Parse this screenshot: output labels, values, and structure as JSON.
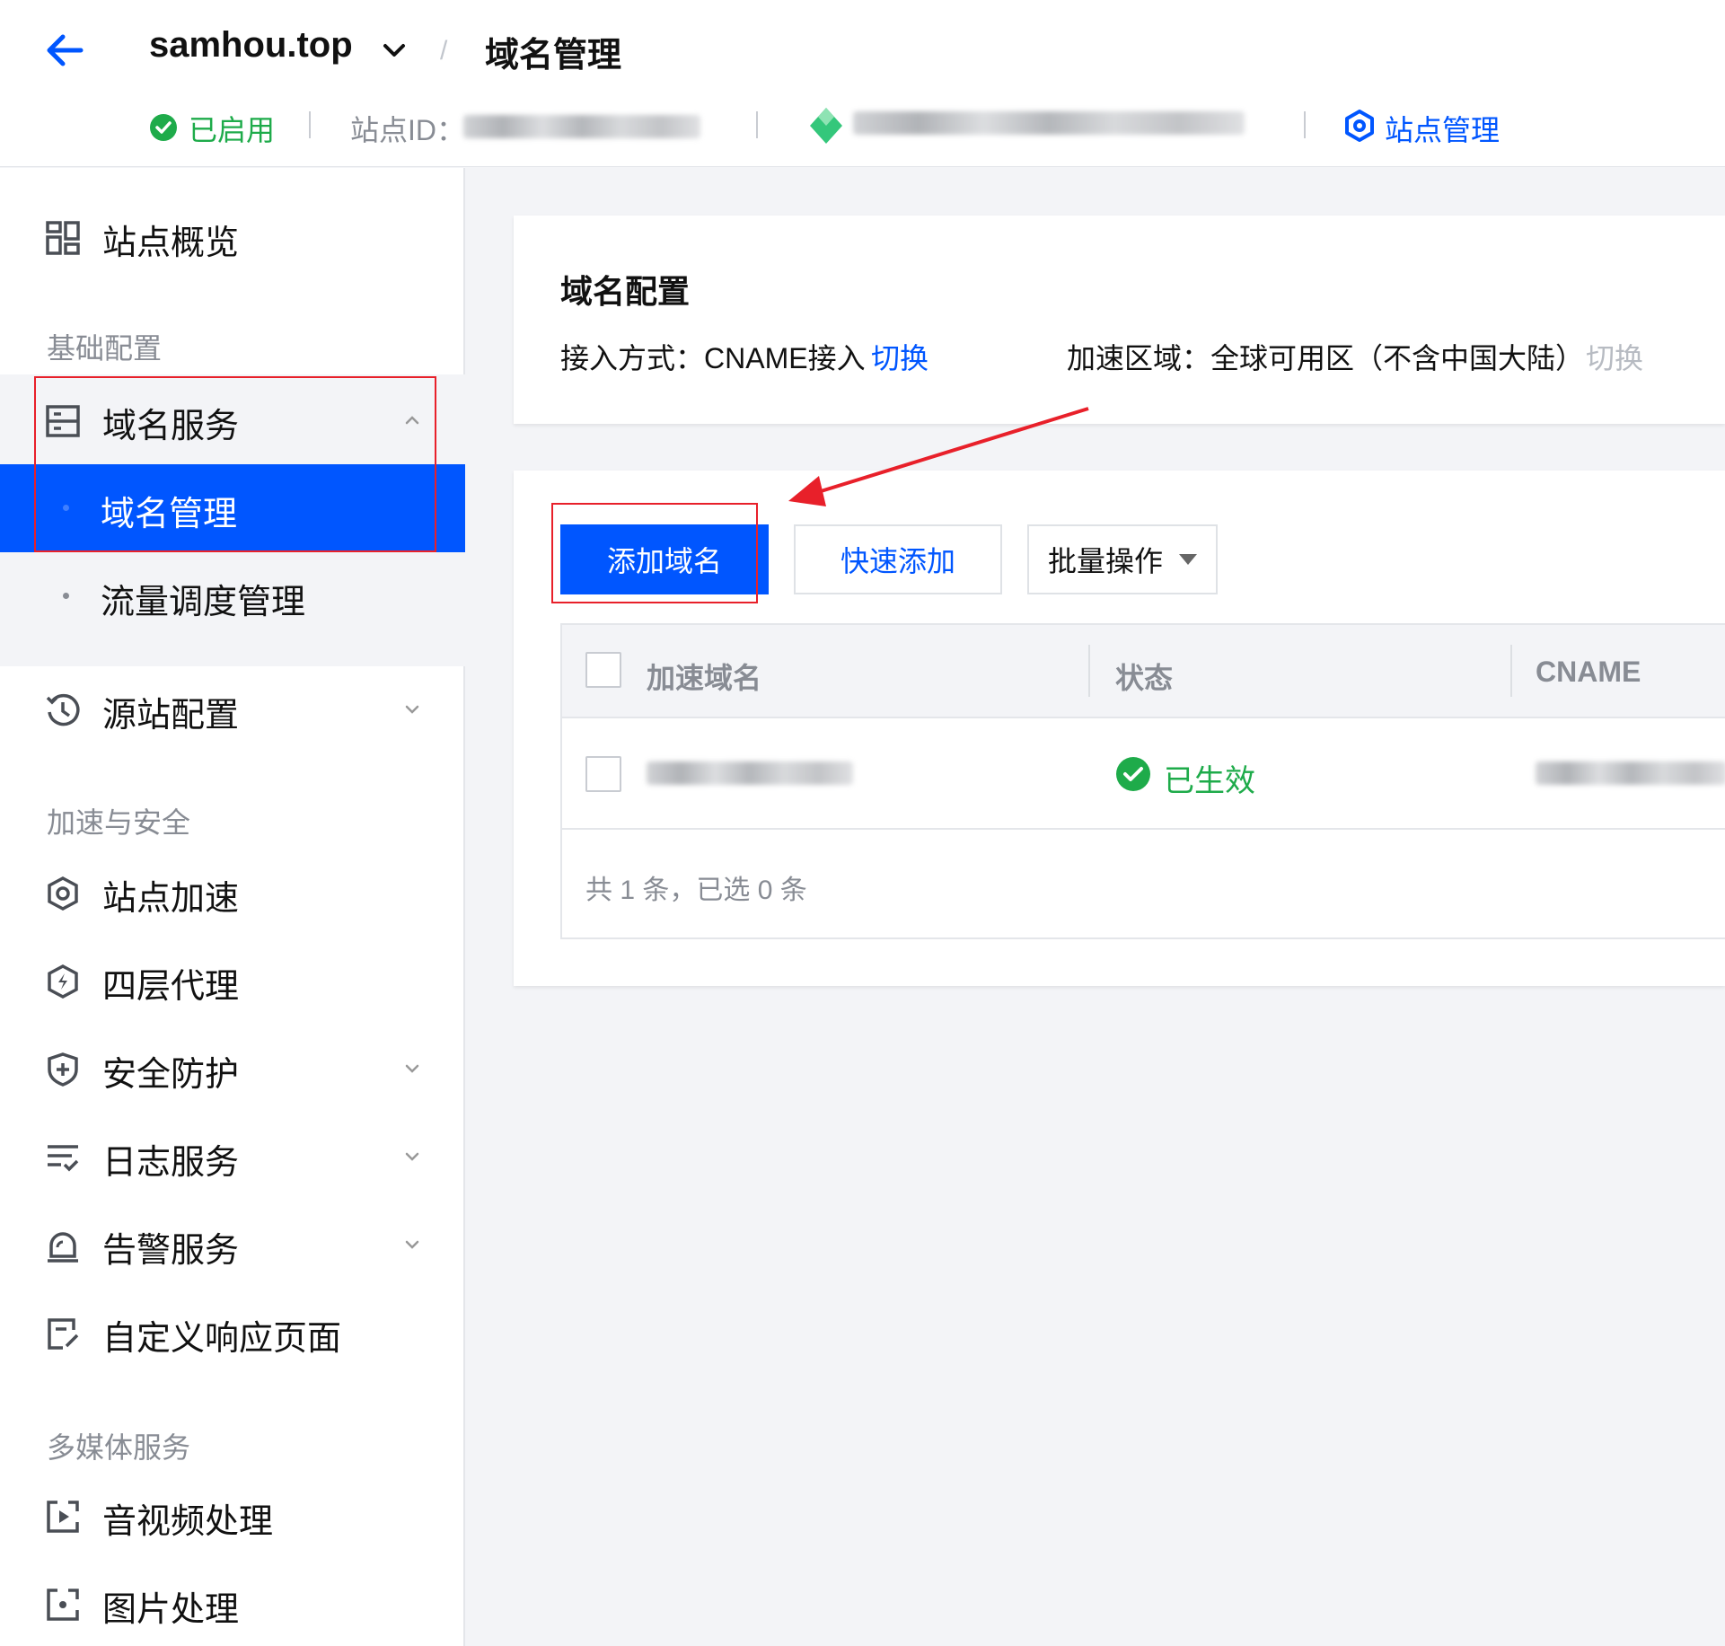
{
  "header": {
    "site_name": "samhou.top",
    "breadcrumb_separator": "/",
    "page_title": "域名管理",
    "status": "已启用",
    "site_id_label": "站点ID：",
    "site_manage": "站点管理"
  },
  "colors": {
    "primary": "#0056ff",
    "success": "#1eab4a",
    "muted": "#888c94",
    "annotation": "#e8202a"
  },
  "sidebar": {
    "overview": "站点概览",
    "group_basic": "基础配置",
    "domain_service": "域名服务",
    "domain_manage": "域名管理",
    "traffic_manage": "流量调度管理",
    "origin_config": "源站配置",
    "group_accel": "加速与安全",
    "site_accel": "站点加速",
    "l4_proxy": "四层代理",
    "security": "安全防护",
    "log_service": "日志服务",
    "alert_service": "告警服务",
    "custom_page": "自定义响应页面",
    "group_media": "多媒体服务",
    "av_process": "音视频处理",
    "image_process": "图片处理"
  },
  "config_card": {
    "title": "域名配置",
    "access_label": "接入方式：CNAME接入",
    "access_switch": "切换",
    "region_label": "加速区域：全球可用区（不含中国大陆）",
    "region_switch": "切换"
  },
  "toolbar": {
    "add_domain": "添加域名",
    "quick_add": "快速添加",
    "batch_ops": "批量操作"
  },
  "table": {
    "columns": [
      "加速域名",
      "状态",
      "CNAME"
    ],
    "rows": [
      {
        "status": "已生效"
      }
    ],
    "footer": "共 1 条，已选 0 条"
  }
}
